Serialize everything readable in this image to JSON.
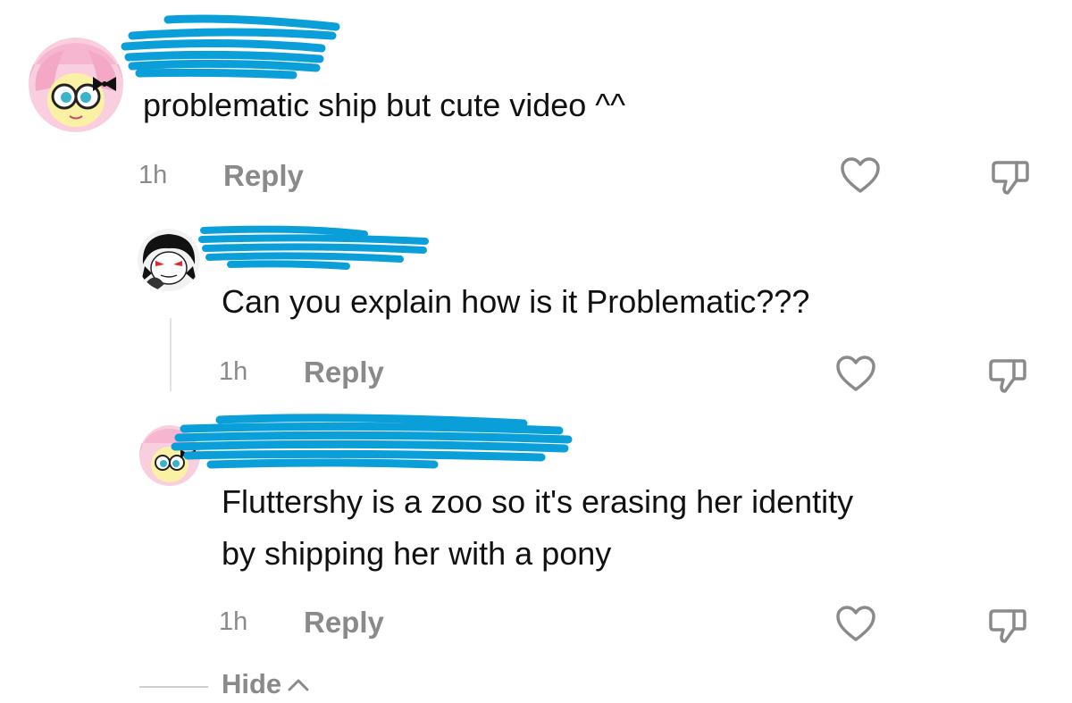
{
  "comments": [
    {
      "text": "problematic ship but cute video ^^",
      "time": "1h",
      "reply_label": "Reply"
    },
    {
      "text": "Can you explain how is it Problematic???",
      "time": "1h",
      "reply_label": "Reply"
    },
    {
      "text_lines": [
        "Fluttershy is a zoo so it's erasing her identity",
        "by shipping her with a pony"
      ],
      "time": "1h",
      "reply_label": "Reply"
    }
  ],
  "hide_label": "Hide",
  "colors": {
    "meta_gray": "#8a8a8a",
    "redaction_blue": "#0a9fd8",
    "text": "#111111"
  },
  "icons": [
    "heart-icon",
    "dislike-icon",
    "chevron-up-icon"
  ]
}
